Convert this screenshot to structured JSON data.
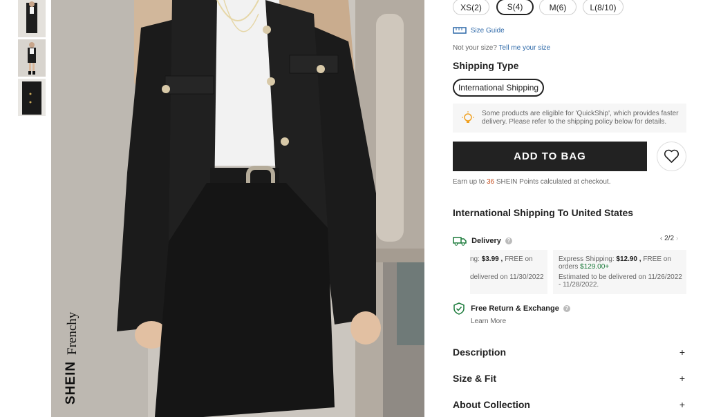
{
  "sizes": {
    "options": [
      "XS(2)",
      "S(4)",
      "M(6)",
      "L(8/10)"
    ],
    "selected": "S(4)"
  },
  "size_guide": {
    "label": "Size Guide"
  },
  "not_your_size": {
    "prefix": "Not your size?",
    "link": "Tell me your size"
  },
  "shipping_type": {
    "heading": "Shipping Type",
    "option": "International Shipping",
    "notice": "Some products are eligible for 'QuickShip', which provides faster delivery. Please refer to the shipping policy below for details."
  },
  "cta": {
    "add_to_bag": "ADD TO BAG"
  },
  "points": {
    "prefix": "Earn up to",
    "value": "36",
    "suffix": "SHEIN Points calculated at checkout."
  },
  "international": {
    "heading": "International Shipping To United States"
  },
  "delivery": {
    "label": "Delivery",
    "pager": "2/2",
    "card1": {
      "line1_prefix": "ng:",
      "price": "$3.99",
      "sep": ",",
      "free": "FREE on",
      "line2": "delivered on 11/30/2022"
    },
    "card2": {
      "line1_prefix": "Express Shipping:",
      "price": "$12.90",
      "sep": ",",
      "free": "FREE on orders",
      "threshold": "$129.00+",
      "estimate": "Estimated to be delivered on 11/26/2022 - 11/28/2022."
    }
  },
  "returns": {
    "label": "Free Return & Exchange",
    "learn_more": "Learn More"
  },
  "accordions": {
    "description": "Description",
    "size_fit": "Size & Fit",
    "about": "About Collection",
    "plus": "+"
  },
  "brand": {
    "name": "SHEIN",
    "sub": "Frenchy"
  },
  "colors": {
    "accent_blue": "#2d68a8",
    "points_orange": "#c44a1a",
    "free_green": "#1a7a3a",
    "button_black": "#222222"
  }
}
